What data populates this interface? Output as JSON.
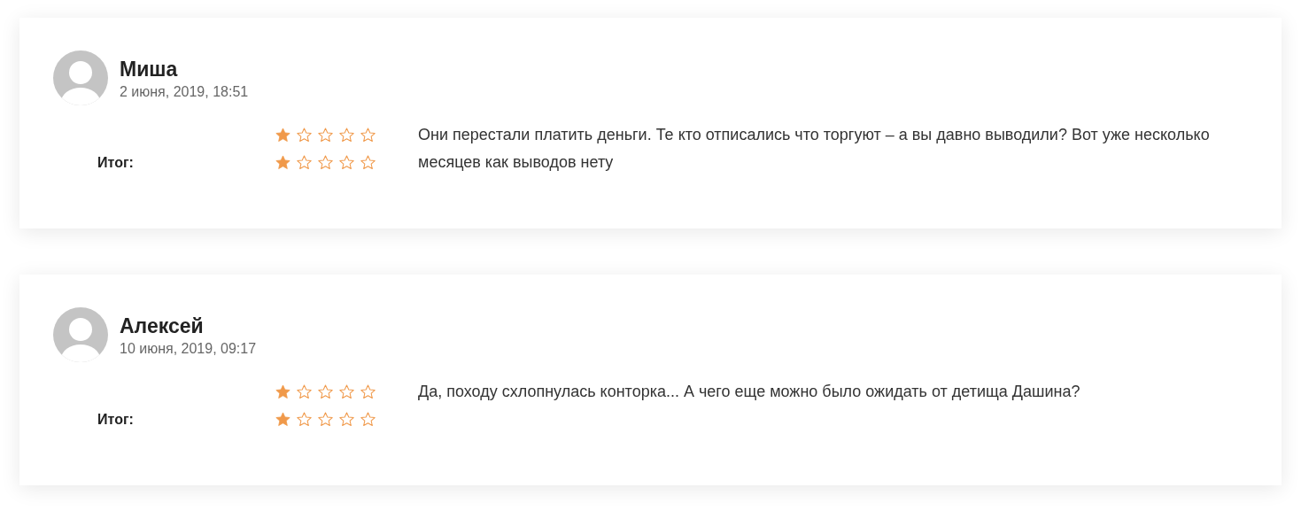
{
  "reviews": [
    {
      "name": "Миша",
      "date": "2 июня, 2019, 18:51",
      "ratings": [
        {
          "stars": 1
        },
        {
          "label": "Итог:",
          "stars": 1
        }
      ],
      "text": "Они перестали платить деньги. Те кто отписались что торгуют – а вы давно выводили? Вот уже несколько месяцев как выводов нету"
    },
    {
      "name": "Алексей",
      "date": "10 июня, 2019, 09:17",
      "ratings": [
        {
          "stars": 1
        },
        {
          "label": "Итог:",
          "stars": 1
        }
      ],
      "text": "Да, походу схлопнулась конторка... А чего еще можно было ожидать от детища Дашина?"
    }
  ]
}
